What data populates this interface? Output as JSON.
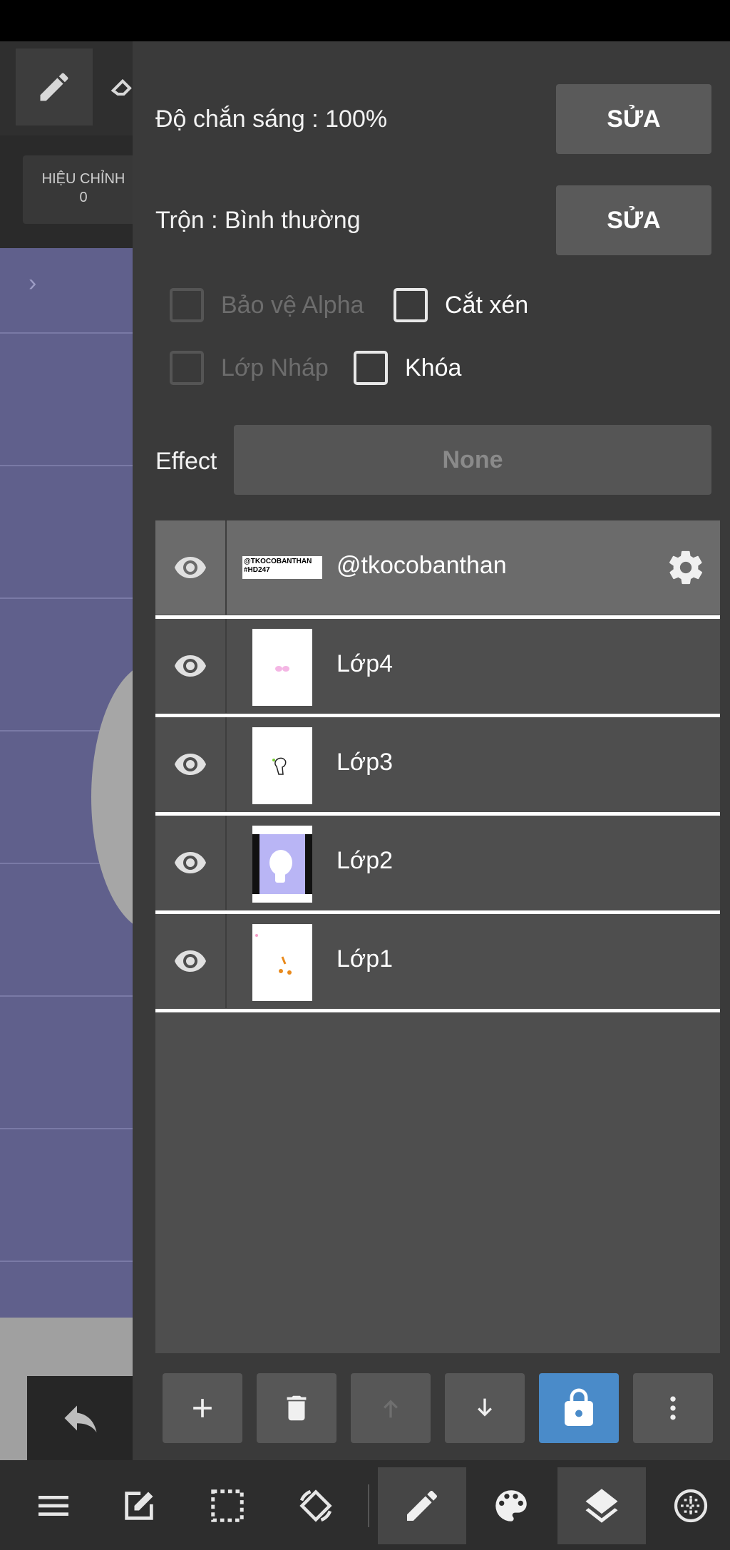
{
  "background_app": {
    "hieu_chinh_label": "HIỆU CHỈNH",
    "hieu_chinh_value": "0"
  },
  "layer_properties": {
    "opacity_label": "Độ chắn sáng : 100%",
    "opacity_edit": "SỬA",
    "blend_label": "Trộn : Bình thường",
    "blend_edit": "SỬA",
    "protect_alpha": "Bảo vệ Alpha",
    "clipping": "Cắt xén",
    "draft_layer": "Lớp Nháp",
    "lock": "Khóa",
    "effect_label": "Effect",
    "effect_value": "None"
  },
  "layers": [
    {
      "name": "@tkocobanthan",
      "selected": true,
      "visible": true,
      "thumb_text_1": "@TKOCOBANTHAN",
      "thumb_text_2": "#HD247"
    },
    {
      "name": "Lớp4",
      "selected": false,
      "visible": true
    },
    {
      "name": "Lớp3",
      "selected": false,
      "visible": true
    },
    {
      "name": "Lớp2",
      "selected": false,
      "visible": true
    },
    {
      "name": "Lớp1",
      "selected": false,
      "visible": true
    }
  ],
  "colors": {
    "panel_bg": "#3a3a3a",
    "layer_list_bg": "#4e4e4e",
    "selected_layer": "#6b6b6b",
    "accent_blue": "#4a8bc9",
    "canvas_bg": "#60608c"
  },
  "layer_actions": [
    "plus-icon",
    "trash-icon",
    "arrow-up-icon",
    "arrow-down-icon",
    "lock-icon",
    "more-vertical-icon"
  ],
  "bottom_toolbar": [
    "menu-icon",
    "edit-icon",
    "selection-icon",
    "rotate-icon",
    "pen-icon",
    "palette-icon",
    "layers-icon",
    "globe-icon"
  ]
}
